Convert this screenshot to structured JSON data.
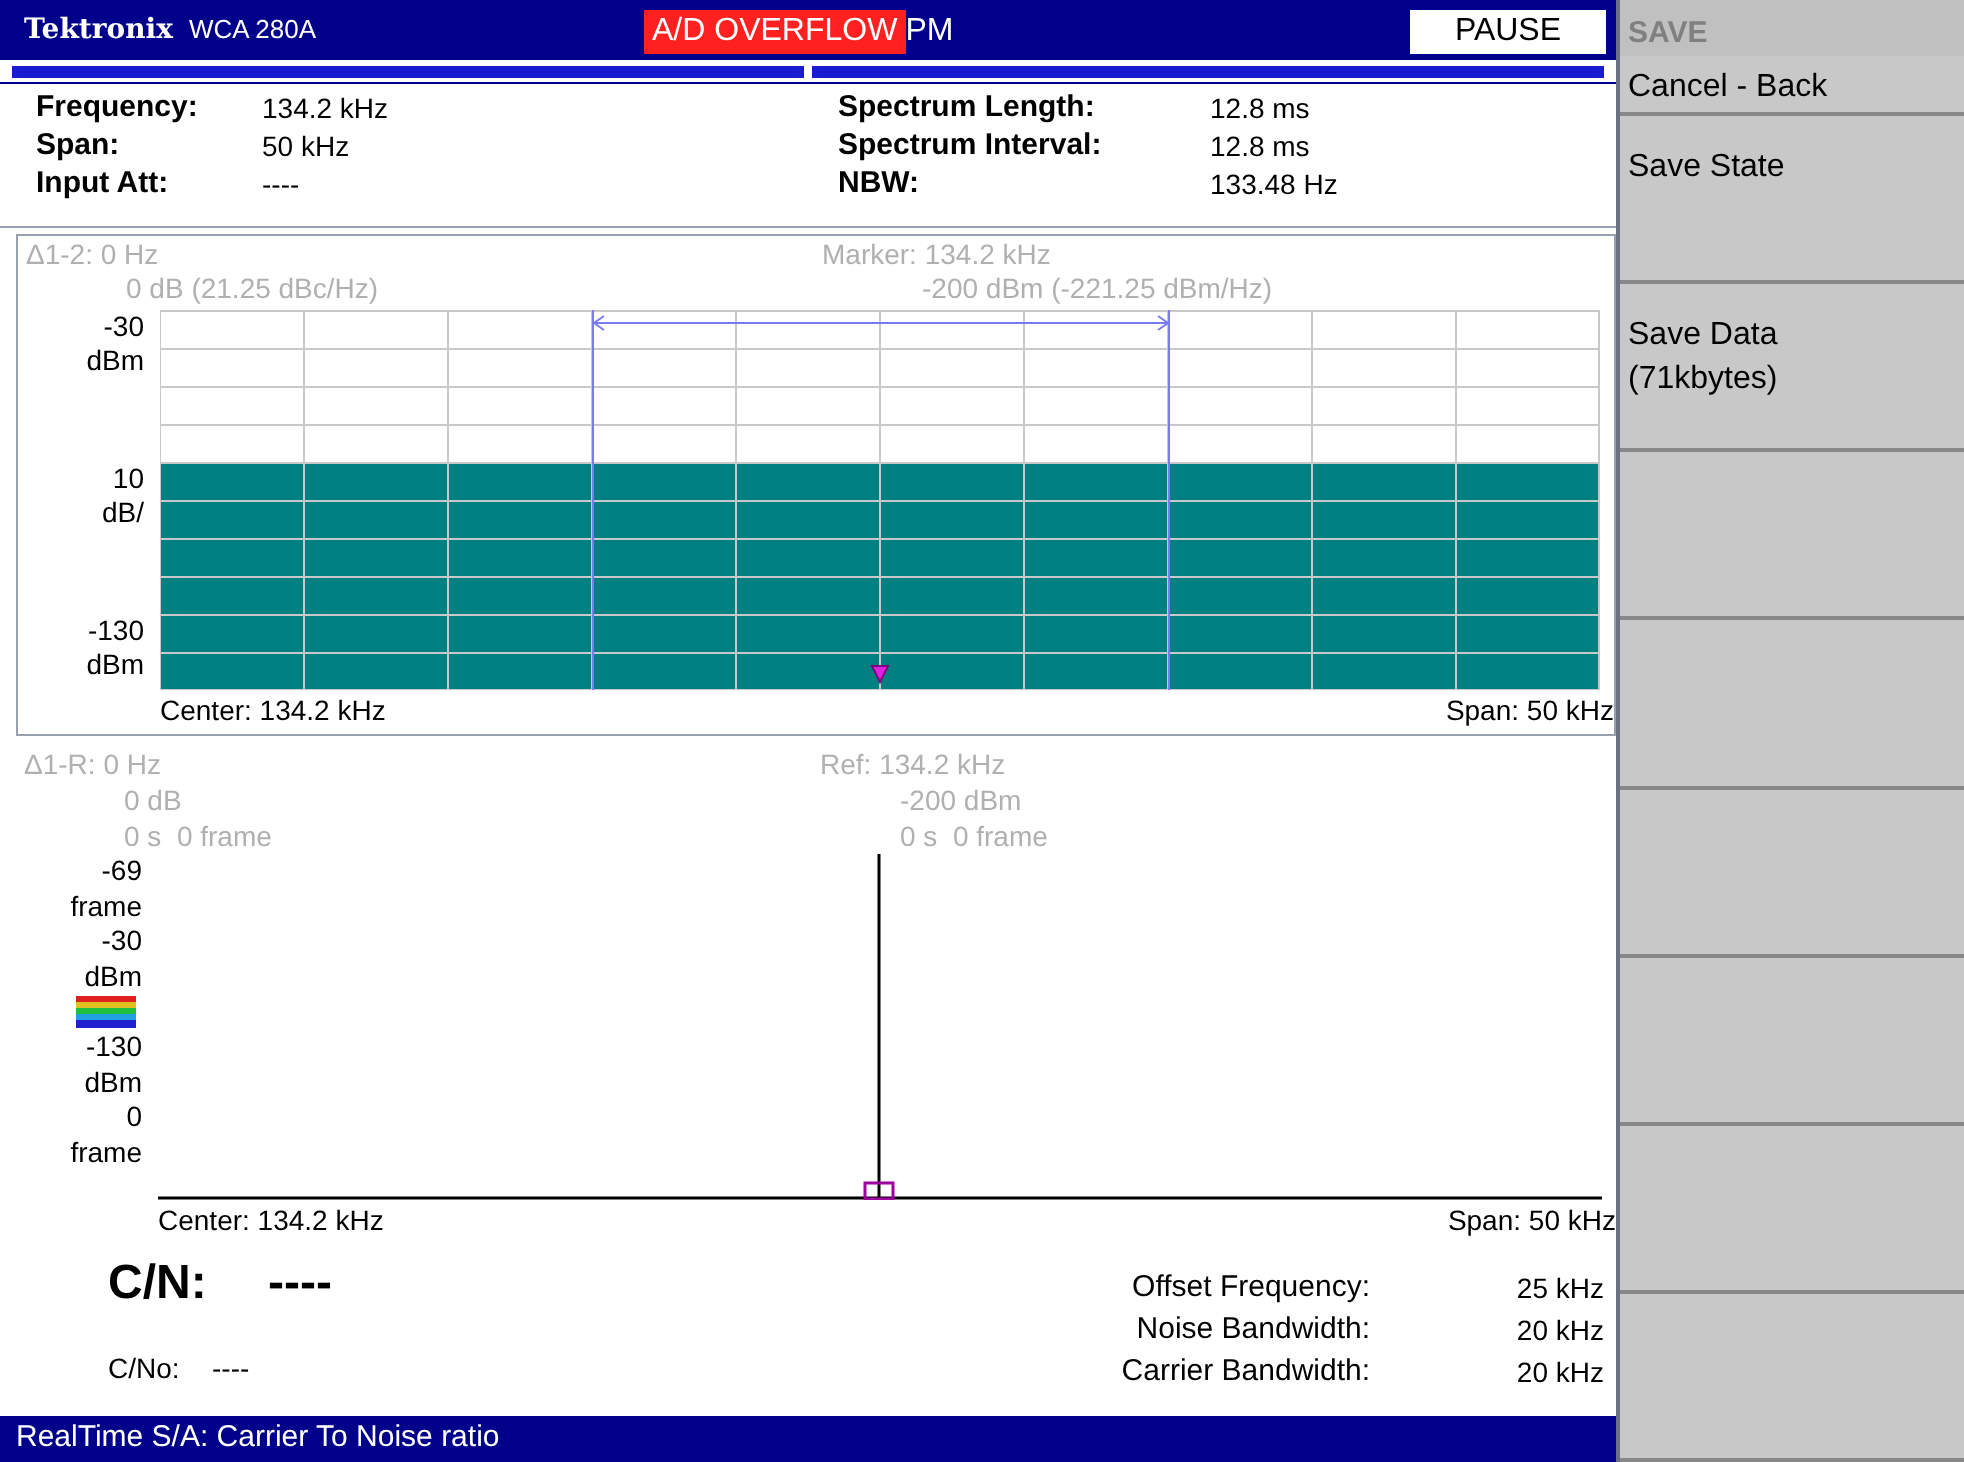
{
  "header": {
    "brand": "Tektronix",
    "model": "WCA 280A",
    "alert": "A/D OVERFLOW",
    "alert_trailing": "PM",
    "pause_button": "PAUSE"
  },
  "parameters_left": [
    {
      "label": "Frequency:",
      "value": "134.2 kHz"
    },
    {
      "label": "Span:",
      "value": "50 kHz"
    },
    {
      "label": "Input Att:",
      "value": "----"
    }
  ],
  "parameters_right": [
    {
      "label": "Spectrum Length:",
      "value": "12.8 ms"
    },
    {
      "label": "Spectrum Interval:",
      "value": "12.8 ms"
    },
    {
      "label": "NBW:",
      "value": "133.48 Hz"
    }
  ],
  "spectrum": {
    "delta_readout": [
      "Δ1-2: 0 Hz",
      "0 dB (21.25 dBc/Hz)"
    ],
    "marker_readout": [
      "Marker: 134.2 kHz",
      "-200 dBm (-221.25 dBm/Hz)"
    ],
    "y_labels": [
      {
        "value": "-30",
        "unit": "dBm"
      },
      {
        "value": "10",
        "unit": "dB/"
      },
      {
        "value": "-130",
        "unit": "dBm"
      }
    ],
    "center": "Center: 134.2 kHz",
    "span": "Span: 50 kHz"
  },
  "spectrogram": {
    "delta_readout": [
      "Δ1-R: 0 Hz",
      "0 dB",
      "0 s  0 frame"
    ],
    "ref_readout": [
      "Ref: 134.2 kHz",
      "-200 dBm",
      "0 s  0 frame"
    ],
    "y_labels": [
      {
        "kind": "label",
        "value": "-69",
        "unit": "frame"
      },
      {
        "kind": "label",
        "value": "-30",
        "unit": "dBm"
      },
      {
        "kind": "colorbar"
      },
      {
        "kind": "label",
        "value": "-130",
        "unit": "dBm"
      },
      {
        "kind": "label",
        "value": "0",
        "unit": "frame"
      }
    ],
    "center": "Center: 134.2 kHz",
    "span": "Span: 50 kHz"
  },
  "results": {
    "cn_label": "C/N:",
    "cn_value": "----",
    "cno_label": "C/No:",
    "cno_value": "----",
    "settings": [
      {
        "label": "Offset Frequency:",
        "value": "25 kHz"
      },
      {
        "label": "Noise Bandwidth:",
        "value": "20 kHz"
      },
      {
        "label": "Carrier Bandwidth:",
        "value": "20 kHz"
      }
    ]
  },
  "status_bar": "RealTime S/A: Carrier To Noise ratio",
  "menu": {
    "title": "SAVE",
    "items": [
      {
        "kind": "button",
        "label": "Cancel - Back"
      },
      {
        "kind": "button",
        "label": "Save State"
      },
      {
        "kind": "button",
        "label": "Save Data (71kbytes)"
      },
      {
        "kind": "blank"
      },
      {
        "kind": "blank"
      },
      {
        "kind": "blank"
      },
      {
        "kind": "blank"
      },
      {
        "kind": "blank"
      },
      {
        "kind": "blank"
      }
    ]
  }
}
